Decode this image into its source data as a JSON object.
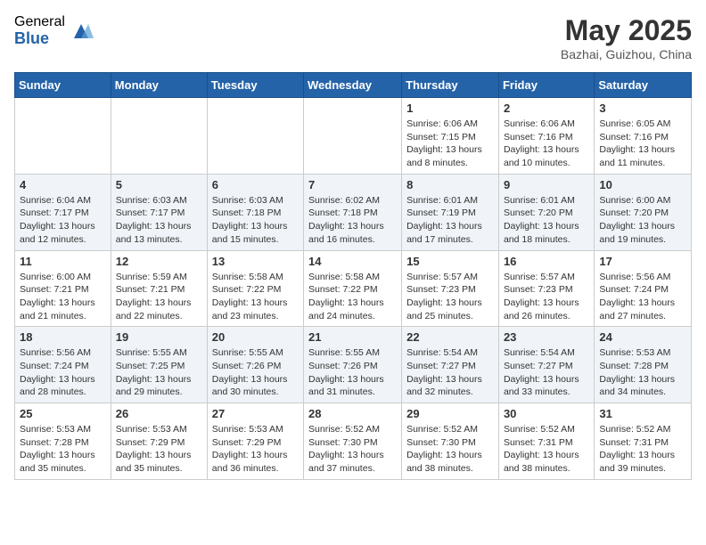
{
  "header": {
    "logo_general": "General",
    "logo_blue": "Blue",
    "month_title": "May 2025",
    "location": "Bazhai, Guizhou, China"
  },
  "weekdays": [
    "Sunday",
    "Monday",
    "Tuesday",
    "Wednesday",
    "Thursday",
    "Friday",
    "Saturday"
  ],
  "weeks": [
    [
      {
        "day": "",
        "info": ""
      },
      {
        "day": "",
        "info": ""
      },
      {
        "day": "",
        "info": ""
      },
      {
        "day": "",
        "info": ""
      },
      {
        "day": "1",
        "info": "Sunrise: 6:06 AM\nSunset: 7:15 PM\nDaylight: 13 hours\nand 8 minutes."
      },
      {
        "day": "2",
        "info": "Sunrise: 6:06 AM\nSunset: 7:16 PM\nDaylight: 13 hours\nand 10 minutes."
      },
      {
        "day": "3",
        "info": "Sunrise: 6:05 AM\nSunset: 7:16 PM\nDaylight: 13 hours\nand 11 minutes."
      }
    ],
    [
      {
        "day": "4",
        "info": "Sunrise: 6:04 AM\nSunset: 7:17 PM\nDaylight: 13 hours\nand 12 minutes."
      },
      {
        "day": "5",
        "info": "Sunrise: 6:03 AM\nSunset: 7:17 PM\nDaylight: 13 hours\nand 13 minutes."
      },
      {
        "day": "6",
        "info": "Sunrise: 6:03 AM\nSunset: 7:18 PM\nDaylight: 13 hours\nand 15 minutes."
      },
      {
        "day": "7",
        "info": "Sunrise: 6:02 AM\nSunset: 7:18 PM\nDaylight: 13 hours\nand 16 minutes."
      },
      {
        "day": "8",
        "info": "Sunrise: 6:01 AM\nSunset: 7:19 PM\nDaylight: 13 hours\nand 17 minutes."
      },
      {
        "day": "9",
        "info": "Sunrise: 6:01 AM\nSunset: 7:20 PM\nDaylight: 13 hours\nand 18 minutes."
      },
      {
        "day": "10",
        "info": "Sunrise: 6:00 AM\nSunset: 7:20 PM\nDaylight: 13 hours\nand 19 minutes."
      }
    ],
    [
      {
        "day": "11",
        "info": "Sunrise: 6:00 AM\nSunset: 7:21 PM\nDaylight: 13 hours\nand 21 minutes."
      },
      {
        "day": "12",
        "info": "Sunrise: 5:59 AM\nSunset: 7:21 PM\nDaylight: 13 hours\nand 22 minutes."
      },
      {
        "day": "13",
        "info": "Sunrise: 5:58 AM\nSunset: 7:22 PM\nDaylight: 13 hours\nand 23 minutes."
      },
      {
        "day": "14",
        "info": "Sunrise: 5:58 AM\nSunset: 7:22 PM\nDaylight: 13 hours\nand 24 minutes."
      },
      {
        "day": "15",
        "info": "Sunrise: 5:57 AM\nSunset: 7:23 PM\nDaylight: 13 hours\nand 25 minutes."
      },
      {
        "day": "16",
        "info": "Sunrise: 5:57 AM\nSunset: 7:23 PM\nDaylight: 13 hours\nand 26 minutes."
      },
      {
        "day": "17",
        "info": "Sunrise: 5:56 AM\nSunset: 7:24 PM\nDaylight: 13 hours\nand 27 minutes."
      }
    ],
    [
      {
        "day": "18",
        "info": "Sunrise: 5:56 AM\nSunset: 7:24 PM\nDaylight: 13 hours\nand 28 minutes."
      },
      {
        "day": "19",
        "info": "Sunrise: 5:55 AM\nSunset: 7:25 PM\nDaylight: 13 hours\nand 29 minutes."
      },
      {
        "day": "20",
        "info": "Sunrise: 5:55 AM\nSunset: 7:26 PM\nDaylight: 13 hours\nand 30 minutes."
      },
      {
        "day": "21",
        "info": "Sunrise: 5:55 AM\nSunset: 7:26 PM\nDaylight: 13 hours\nand 31 minutes."
      },
      {
        "day": "22",
        "info": "Sunrise: 5:54 AM\nSunset: 7:27 PM\nDaylight: 13 hours\nand 32 minutes."
      },
      {
        "day": "23",
        "info": "Sunrise: 5:54 AM\nSunset: 7:27 PM\nDaylight: 13 hours\nand 33 minutes."
      },
      {
        "day": "24",
        "info": "Sunrise: 5:53 AM\nSunset: 7:28 PM\nDaylight: 13 hours\nand 34 minutes."
      }
    ],
    [
      {
        "day": "25",
        "info": "Sunrise: 5:53 AM\nSunset: 7:28 PM\nDaylight: 13 hours\nand 35 minutes."
      },
      {
        "day": "26",
        "info": "Sunrise: 5:53 AM\nSunset: 7:29 PM\nDaylight: 13 hours\nand 35 minutes."
      },
      {
        "day": "27",
        "info": "Sunrise: 5:53 AM\nSunset: 7:29 PM\nDaylight: 13 hours\nand 36 minutes."
      },
      {
        "day": "28",
        "info": "Sunrise: 5:52 AM\nSunset: 7:30 PM\nDaylight: 13 hours\nand 37 minutes."
      },
      {
        "day": "29",
        "info": "Sunrise: 5:52 AM\nSunset: 7:30 PM\nDaylight: 13 hours\nand 38 minutes."
      },
      {
        "day": "30",
        "info": "Sunrise: 5:52 AM\nSunset: 7:31 PM\nDaylight: 13 hours\nand 38 minutes."
      },
      {
        "day": "31",
        "info": "Sunrise: 5:52 AM\nSunset: 7:31 PM\nDaylight: 13 hours\nand 39 minutes."
      }
    ]
  ]
}
